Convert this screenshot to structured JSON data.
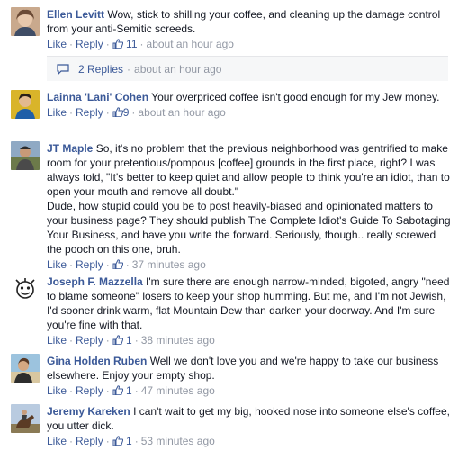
{
  "comments": [
    {
      "author": "Ellen Levitt",
      "text": "Wow, stick to shilling your coffee, and cleaning up the damage control from your anti-Semitic screeds.",
      "like_label": "Like",
      "reply_label": "Reply",
      "likes": "11",
      "time": "about an hour ago",
      "avatar_icon": "profile-photo-woman-icon"
    },
    {
      "author": "Lainna 'Lani' Cohen",
      "text": "Your overpriced coffee isn't good enough for my Jew money.",
      "like_label": "Like",
      "reply_label": "Reply",
      "likes": "9",
      "time": "about an hour ago",
      "avatar_icon": "profile-photo-yellow-icon"
    },
    {
      "author": "JT Maple",
      "text": "So, it's no problem that the previous neighborhood was gentrified to make room for your pretentious/pompous [coffee] grounds in the first place, right? I was always told, \"It's better to keep quiet and allow people to think you're an idiot, than to open your mouth and remove all doubt.\"\nDude, how stupid could you be to post heavily-biased and opinionated matters to your business page? They should publish The Complete Idiot's Guide To Sabotaging Your Business, and have you write the forward. Seriously, though.. really screwed the pooch on this one, bruh.",
      "like_label": "Like",
      "reply_label": "Reply",
      "likes": "",
      "time": "37 minutes ago",
      "avatar_icon": "profile-photo-outdoor-icon"
    },
    {
      "author": "Joseph F. Mazzella",
      "text": "I'm sure there are enough narrow-minded, bigoted, angry \"need to blame someone\" losers to keep your shop humming. But me, and I'm not Jewish, I'd sooner drink warm, flat Mountain Dew than darken your doorway. And I'm sure you're fine with that.",
      "like_label": "Like",
      "reply_label": "Reply",
      "likes": "1",
      "time": "38 minutes ago",
      "avatar_icon": "profile-photo-emblem-icon"
    },
    {
      "author": "Gina Holden Ruben",
      "text": "Well we don't love you and we're happy to take our business elsewhere. Enjoy your empty shop.",
      "like_label": "Like",
      "reply_label": "Reply",
      "likes": "1",
      "time": "47 minutes ago",
      "avatar_icon": "profile-photo-beach-icon"
    },
    {
      "author": "Jeremy Kareken",
      "text": "I can't wait to get my big, hooked nose into someone else's coffee, you utter dick.",
      "like_label": "Like",
      "reply_label": "Reply",
      "likes": "1",
      "time": "53 minutes ago",
      "avatar_icon": "profile-photo-horse-icon"
    }
  ],
  "replies": {
    "label": "2 Replies",
    "time": "about an hour ago",
    "icon": "reply-arrow-icon"
  },
  "colors": {
    "link": "#3b5998",
    "meta": "#9197a3",
    "text": "#141823",
    "reply_bg": "#f6f7f8"
  }
}
